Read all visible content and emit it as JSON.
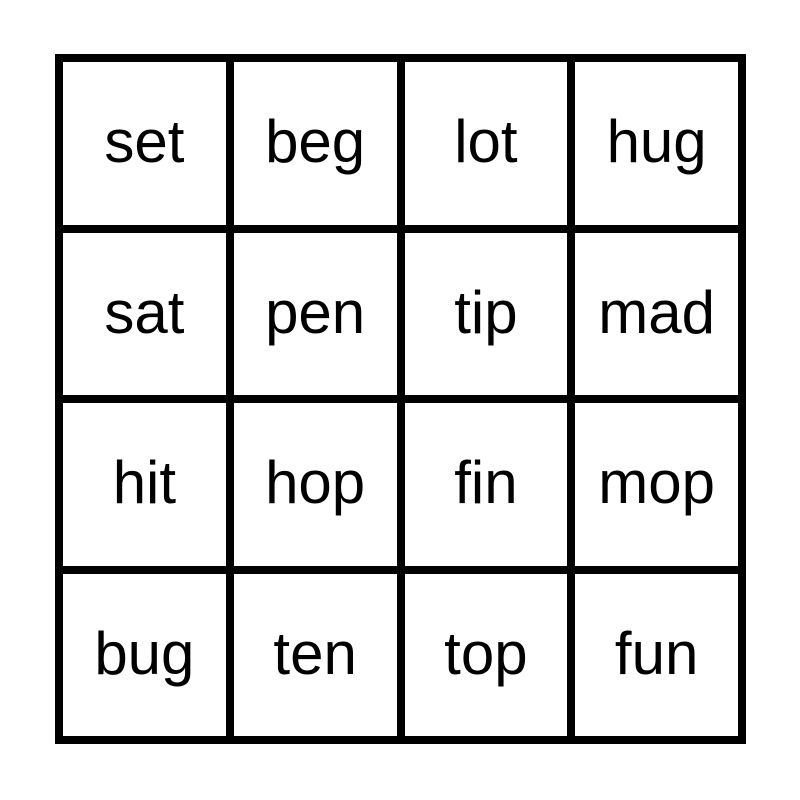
{
  "card": {
    "type": "bingo-word-grid",
    "rows": 4,
    "columns": 4,
    "cell_count": 16,
    "background_color": "#ffffff",
    "grid_line_color": "#000000",
    "text_color": "#000000",
    "cells": [
      {
        "row": 1,
        "column": 1,
        "word": "set"
      },
      {
        "row": 1,
        "column": 2,
        "word": "beg"
      },
      {
        "row": 1,
        "column": 3,
        "word": "lot"
      },
      {
        "row": 1,
        "column": 4,
        "word": "hug"
      },
      {
        "row": 2,
        "column": 1,
        "word": "sat"
      },
      {
        "row": 2,
        "column": 2,
        "word": "pen"
      },
      {
        "row": 2,
        "column": 3,
        "word": "tip"
      },
      {
        "row": 2,
        "column": 4,
        "word": "mad"
      },
      {
        "row": 3,
        "column": 1,
        "word": "hit"
      },
      {
        "row": 3,
        "column": 2,
        "word": "hop"
      },
      {
        "row": 3,
        "column": 3,
        "word": "fin"
      },
      {
        "row": 3,
        "column": 4,
        "word": "mop"
      },
      {
        "row": 4,
        "column": 1,
        "word": "bug"
      },
      {
        "row": 4,
        "column": 2,
        "word": "ten"
      },
      {
        "row": 4,
        "column": 3,
        "word": "top"
      },
      {
        "row": 4,
        "column": 4,
        "word": "fun"
      }
    ]
  }
}
